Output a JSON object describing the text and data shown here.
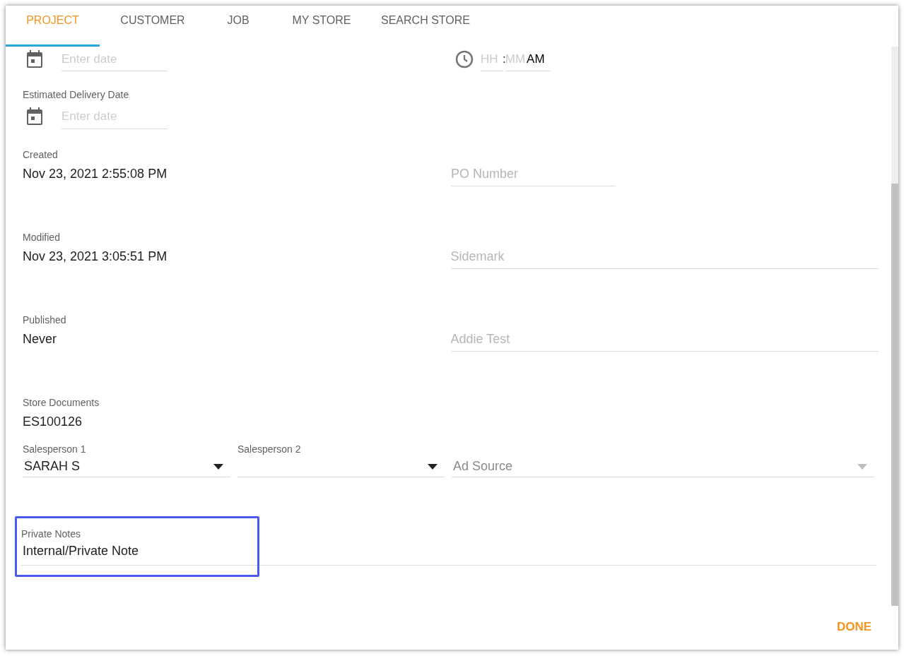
{
  "tabs": [
    {
      "label": "PROJECT",
      "selected": true
    },
    {
      "label": "CUSTOMER",
      "selected": false
    },
    {
      "label": "JOB",
      "selected": false
    },
    {
      "label": "MY STORE",
      "selected": false
    },
    {
      "label": "SEARCH STORE",
      "selected": false
    }
  ],
  "top_date_field": {
    "placeholder": "Enter date"
  },
  "time_field": {
    "hour_placeholder": "HH",
    "separator": ":",
    "minute_placeholder": "MM",
    "period": "AM"
  },
  "estimated_delivery_date": {
    "label": "Estimated Delivery Date",
    "placeholder": "Enter date"
  },
  "info_rows": [
    {
      "label": "Created",
      "value": "Nov 23, 2021 2:55:08 PM",
      "field": {
        "placeholder": "PO Number",
        "kind": "short"
      }
    },
    {
      "label": "Modified",
      "value": "Nov 23, 2021 3:05:51 PM",
      "field": {
        "placeholder": "Sidemark",
        "kind": "wide"
      }
    },
    {
      "label": "Published",
      "value": "Never",
      "field": {
        "placeholder": "Addie Test",
        "kind": "wide"
      }
    },
    {
      "label": "Store Documents",
      "value": "ES100126"
    }
  ],
  "selects": [
    {
      "label": "Salesperson 1",
      "value": "SARAH S",
      "disabled": false
    },
    {
      "label": "Salesperson 2",
      "disabled": false
    },
    {
      "placeholder": "Ad Source",
      "disabled": true
    }
  ],
  "private_notes": {
    "label": "Private Notes",
    "value": "Internal/Private Note",
    "highlighted": true
  },
  "done_button": "DONE"
}
